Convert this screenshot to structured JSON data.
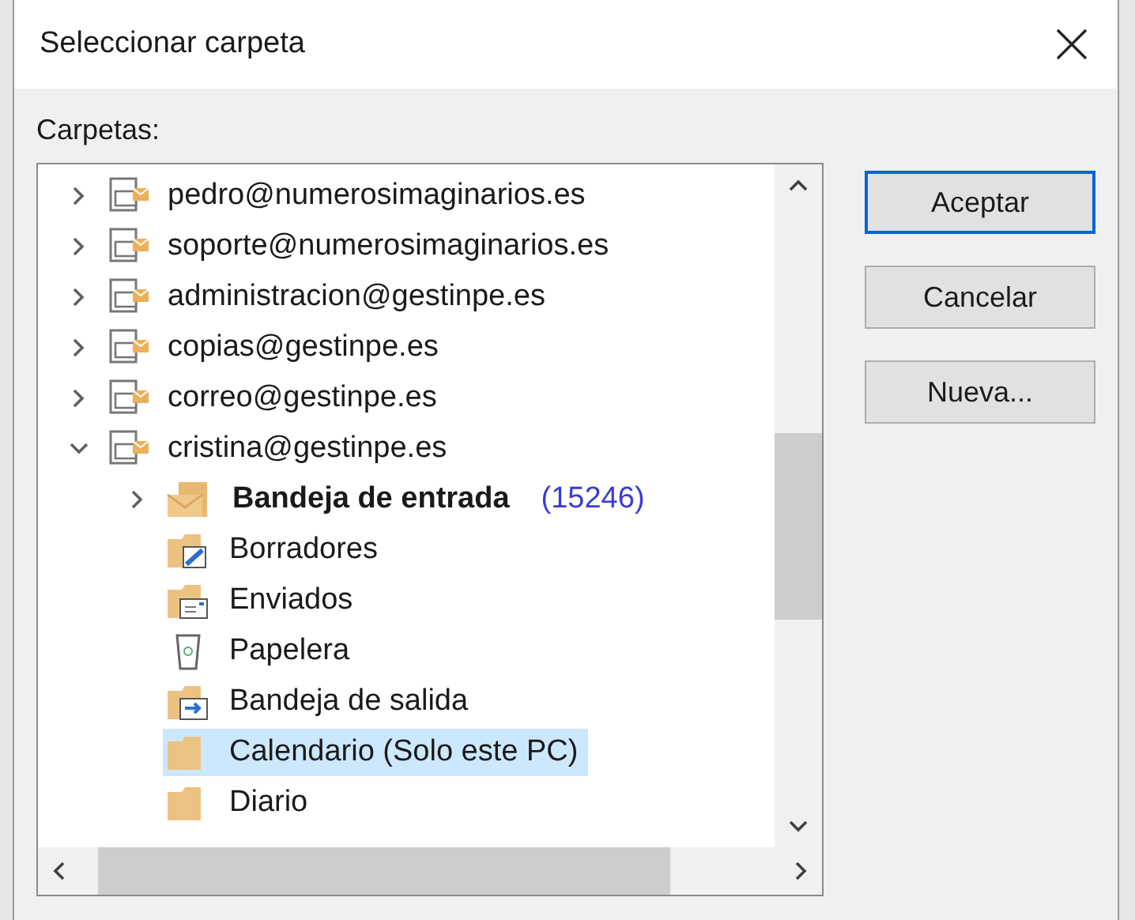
{
  "dialog": {
    "title": "Seleccionar carpeta"
  },
  "tree": {
    "label": "Carpetas:",
    "items": [
      {
        "kind": "account",
        "label": "pedro@numerosimaginarios.es",
        "expanded": false,
        "selected": false
      },
      {
        "kind": "account",
        "label": "soporte@numerosimaginarios.es",
        "expanded": false,
        "selected": false
      },
      {
        "kind": "account",
        "label": "administracion@gestinpe.es",
        "expanded": false,
        "selected": false
      },
      {
        "kind": "account",
        "label": "copias@gestinpe.es",
        "expanded": false,
        "selected": false
      },
      {
        "kind": "account",
        "label": "correo@gestinpe.es",
        "expanded": false,
        "selected": false
      },
      {
        "kind": "account",
        "label": "cristina@gestinpe.es",
        "expanded": true,
        "selected": false,
        "children": [
          {
            "kind": "inbox",
            "label": "Bandeja de entrada",
            "count": "(15246)",
            "expanded": false,
            "selected": false
          },
          {
            "kind": "drafts",
            "label": "Borradores",
            "selected": false
          },
          {
            "kind": "sent",
            "label": "Enviados",
            "selected": false
          },
          {
            "kind": "trash",
            "label": "Papelera",
            "selected": false
          },
          {
            "kind": "outbox",
            "label": "Bandeja de salida",
            "selected": false
          },
          {
            "kind": "folder",
            "label": "Calendario (Solo este PC)",
            "selected": true
          },
          {
            "kind": "folder",
            "label": "Diario",
            "selected": false
          }
        ]
      }
    ]
  },
  "buttons": [
    {
      "label": "Aceptar",
      "default": true
    },
    {
      "label": "Cancelar",
      "default": false
    },
    {
      "label": "Nueva...",
      "default": false
    }
  ]
}
